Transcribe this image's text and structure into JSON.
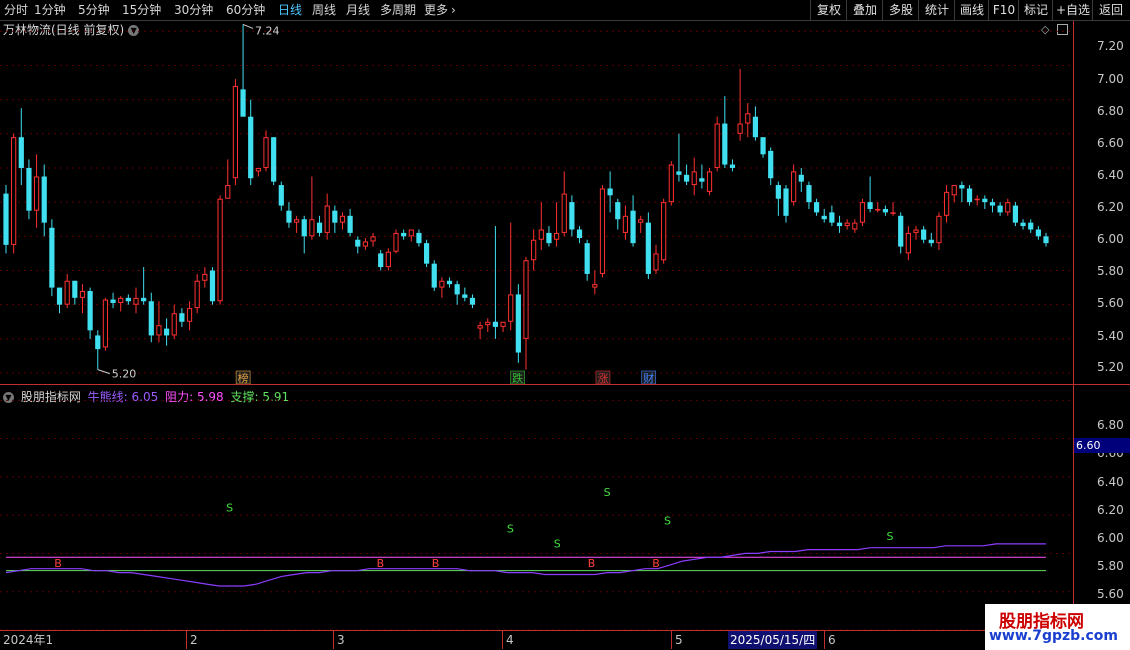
{
  "toolbar": {
    "periods": [
      "分时",
      "1分钟",
      "5分钟",
      "15分钟",
      "30分钟",
      "60分钟",
      "日线",
      "周线",
      "月线",
      "多周期",
      "更多"
    ],
    "active": "日线",
    "right_buttons": [
      "复权",
      "叠加",
      "多股",
      "统计",
      "画线",
      "F10",
      "标记",
      "+自选",
      "返回"
    ]
  },
  "stock": {
    "title": "万林物流(日线 前复权)"
  },
  "main_axis": {
    "ticks": [
      "7.20",
      "7.00",
      "6.80",
      "6.60",
      "6.40",
      "6.20",
      "6.00",
      "5.80",
      "5.60",
      "5.40",
      "5.20"
    ]
  },
  "annotations": {
    "high": "7.24",
    "low": "5.20"
  },
  "event_badges": [
    {
      "label": "榜",
      "color": "#e0a040"
    },
    {
      "label": "跌",
      "color": "#30c030"
    },
    {
      "label": "涨",
      "color": "#e03030"
    },
    {
      "label": "财",
      "color": "#4080ff"
    }
  ],
  "indicator": {
    "name": "股朋指标网",
    "bull_label": "牛熊线:",
    "bull_value": "6.05",
    "resist_label": "阻力:",
    "resist_value": "5.98",
    "support_label": "支撑:",
    "support_value": "5.91",
    "signal_s": "S",
    "signal_b": "B"
  },
  "sub_axis": {
    "ticks": [
      "6.80",
      "6.60",
      "6.40",
      "6.20",
      "6.00",
      "5.80",
      "5.60"
    ],
    "cursor_value": "6.60"
  },
  "date_axis": {
    "labels": [
      "2024年1",
      "2",
      "3",
      "4",
      "5",
      "6"
    ],
    "cursor": "2025/05/15/四"
  },
  "watermark": {
    "title": "股朋指标网",
    "url": "www.7gpzb.com"
  },
  "colors": {
    "up": "#ff3030",
    "down": "#40e0f0",
    "bull": "#8c3cff",
    "resist": "#ff50ff",
    "support": "#60e060"
  },
  "chart_data": {
    "type": "candlestick",
    "price_range": [
      5.13,
      7.26
    ],
    "indicator_range": [
      5.6,
      6.88
    ],
    "candles": [
      [
        6.25,
        6.3,
        5.9,
        5.95
      ],
      [
        5.95,
        6.6,
        5.9,
        6.58
      ],
      [
        6.58,
        6.75,
        6.3,
        6.4
      ],
      [
        6.4,
        6.45,
        6.1,
        6.15
      ],
      [
        6.15,
        6.48,
        6.05,
        6.35
      ],
      [
        6.35,
        6.42,
        6.0,
        6.08
      ],
      [
        6.05,
        6.1,
        5.65,
        5.7
      ],
      [
        5.7,
        5.7,
        5.55,
        5.6
      ],
      [
        5.6,
        5.78,
        5.58,
        5.74
      ],
      [
        5.74,
        5.74,
        5.6,
        5.64
      ],
      [
        5.64,
        5.72,
        5.55,
        5.68
      ],
      [
        5.68,
        5.7,
        5.4,
        5.45
      ],
      [
        5.42,
        5.45,
        5.22,
        5.34
      ],
      [
        5.35,
        5.64,
        5.33,
        5.63
      ],
      [
        5.63,
        5.67,
        5.58,
        5.61
      ],
      [
        5.61,
        5.65,
        5.56,
        5.64
      ],
      [
        5.64,
        5.66,
        5.6,
        5.62
      ],
      [
        5.6,
        5.7,
        5.55,
        5.64
      ],
      [
        5.64,
        5.82,
        5.6,
        5.62
      ],
      [
        5.62,
        5.67,
        5.38,
        5.42
      ],
      [
        5.42,
        5.62,
        5.38,
        5.48
      ],
      [
        5.46,
        5.52,
        5.36,
        5.42
      ],
      [
        5.42,
        5.6,
        5.4,
        5.55
      ],
      [
        5.55,
        5.58,
        5.47,
        5.5
      ],
      [
        5.5,
        5.62,
        5.45,
        5.58
      ],
      [
        5.58,
        5.78,
        5.55,
        5.74
      ],
      [
        5.74,
        5.82,
        5.7,
        5.78
      ],
      [
        5.8,
        5.82,
        5.6,
        5.62
      ],
      [
        5.62,
        6.24,
        5.6,
        6.22
      ],
      [
        6.22,
        6.45,
        6.22,
        6.3
      ],
      [
        6.34,
        6.92,
        6.3,
        6.88
      ],
      [
        6.86,
        7.24,
        6.78,
        6.7
      ],
      [
        6.7,
        6.8,
        6.3,
        6.34
      ],
      [
        6.38,
        6.4,
        6.35,
        6.4
      ],
      [
        6.4,
        6.62,
        6.38,
        6.58
      ],
      [
        6.58,
        6.58,
        6.3,
        6.32
      ],
      [
        6.3,
        6.32,
        6.15,
        6.18
      ],
      [
        6.15,
        6.2,
        6.05,
        6.08
      ],
      [
        6.08,
        6.12,
        6.02,
        6.1
      ],
      [
        6.1,
        6.12,
        5.9,
        6.0
      ],
      [
        6.0,
        6.35,
        5.98,
        6.1
      ],
      [
        6.08,
        6.12,
        6.0,
        6.02
      ],
      [
        6.02,
        6.25,
        5.98,
        6.18
      ],
      [
        6.15,
        6.18,
        6.02,
        6.08
      ],
      [
        6.08,
        6.14,
        6.04,
        6.12
      ],
      [
        6.12,
        6.16,
        6.0,
        6.02
      ],
      [
        5.98,
        6.0,
        5.9,
        5.94
      ],
      [
        5.94,
        5.99,
        5.92,
        5.97
      ],
      [
        5.97,
        6.02,
        5.94,
        6.0
      ],
      [
        5.9,
        5.92,
        5.8,
        5.82
      ],
      [
        5.82,
        5.93,
        5.8,
        5.91
      ],
      [
        5.91,
        6.04,
        5.9,
        6.02
      ],
      [
        6.02,
        6.04,
        5.98,
        6.0
      ],
      [
        6.0,
        6.04,
        5.97,
        6.04
      ],
      [
        6.02,
        6.04,
        5.94,
        5.96
      ],
      [
        5.96,
        5.98,
        5.82,
        5.84
      ],
      [
        5.84,
        5.86,
        5.68,
        5.7
      ],
      [
        5.7,
        5.76,
        5.64,
        5.74
      ],
      [
        5.74,
        5.76,
        5.7,
        5.72
      ],
      [
        5.72,
        5.74,
        5.6,
        5.66
      ],
      [
        5.66,
        5.7,
        5.62,
        5.64
      ],
      [
        5.64,
        5.66,
        5.58,
        5.6
      ],
      [
        5.46,
        5.5,
        5.4,
        5.48
      ],
      [
        5.48,
        5.52,
        5.44,
        5.5
      ],
      [
        5.5,
        6.06,
        5.4,
        5.47
      ],
      [
        5.47,
        5.5,
        5.44,
        5.5
      ],
      [
        5.5,
        6.08,
        5.45,
        5.66
      ],
      [
        5.66,
        5.72,
        5.26,
        5.32
      ],
      [
        5.4,
        5.88,
        5.22,
        5.86
      ],
      [
        5.86,
        6.04,
        5.8,
        5.98
      ],
      [
        5.98,
        6.2,
        5.92,
        6.04
      ],
      [
        6.02,
        6.06,
        5.94,
        5.96
      ],
      [
        5.98,
        6.2,
        5.94,
        6.02
      ],
      [
        6.02,
        6.38,
        6.0,
        6.25
      ],
      [
        6.2,
        6.24,
        6.0,
        6.04
      ],
      [
        6.04,
        6.06,
        5.96,
        5.99
      ],
      [
        5.96,
        5.98,
        5.74,
        5.78
      ],
      [
        5.7,
        5.8,
        5.66,
        5.72
      ],
      [
        5.78,
        6.3,
        5.76,
        6.28
      ],
      [
        6.28,
        6.38,
        6.14,
        6.24
      ],
      [
        6.2,
        6.22,
        6.04,
        6.1
      ],
      [
        6.02,
        6.18,
        5.98,
        6.12
      ],
      [
        6.15,
        6.24,
        5.94,
        5.96
      ],
      [
        6.08,
        6.12,
        6.02,
        6.1
      ],
      [
        6.08,
        6.14,
        5.75,
        5.78
      ],
      [
        5.8,
        5.95,
        5.78,
        5.9
      ],
      [
        5.86,
        6.22,
        5.84,
        6.2
      ],
      [
        6.2,
        6.44,
        6.18,
        6.42
      ],
      [
        6.38,
        6.6,
        6.32,
        6.36
      ],
      [
        6.36,
        6.42,
        6.3,
        6.32
      ],
      [
        6.3,
        6.46,
        6.24,
        6.38
      ],
      [
        6.34,
        6.42,
        6.28,
        6.32
      ],
      [
        6.26,
        6.4,
        6.24,
        6.38
      ],
      [
        6.4,
        6.7,
        6.38,
        6.66
      ],
      [
        6.66,
        6.82,
        6.4,
        6.42
      ],
      [
        6.42,
        6.45,
        6.38,
        6.4
      ],
      [
        6.6,
        6.98,
        6.56,
        6.66
      ],
      [
        6.66,
        6.78,
        6.58,
        6.72
      ],
      [
        6.7,
        6.76,
        6.56,
        6.58
      ],
      [
        6.58,
        6.58,
        6.46,
        6.48
      ],
      [
        6.5,
        6.52,
        6.3,
        6.34
      ],
      [
        6.3,
        6.32,
        6.12,
        6.22
      ],
      [
        6.28,
        6.3,
        6.08,
        6.12
      ],
      [
        6.2,
        6.42,
        6.18,
        6.38
      ],
      [
        6.36,
        6.4,
        6.26,
        6.32
      ],
      [
        6.3,
        6.32,
        6.16,
        6.2
      ],
      [
        6.2,
        6.22,
        6.12,
        6.14
      ],
      [
        6.12,
        6.16,
        6.08,
        6.1
      ],
      [
        6.14,
        6.18,
        6.06,
        6.08
      ],
      [
        6.08,
        6.12,
        6.02,
        6.06
      ],
      [
        6.06,
        6.1,
        6.04,
        6.08
      ],
      [
        6.04,
        6.1,
        6.02,
        6.08
      ],
      [
        6.08,
        6.22,
        6.06,
        6.2
      ],
      [
        6.2,
        6.35,
        6.14,
        6.16
      ],
      [
        6.16,
        6.2,
        6.14,
        6.16
      ],
      [
        6.16,
        6.18,
        6.12,
        6.14
      ],
      [
        6.14,
        6.2,
        6.12,
        6.14
      ],
      [
        6.12,
        6.14,
        5.9,
        5.94
      ],
      [
        5.9,
        6.06,
        5.86,
        6.02
      ],
      [
        6.02,
        6.06,
        5.98,
        6.04
      ],
      [
        6.04,
        6.06,
        5.96,
        5.98
      ],
      [
        5.98,
        6.02,
        5.94,
        5.96
      ],
      [
        5.96,
        6.14,
        5.92,
        6.12
      ],
      [
        6.12,
        6.3,
        6.08,
        6.26
      ],
      [
        6.24,
        6.3,
        6.2,
        6.3
      ],
      [
        6.3,
        6.32,
        6.2,
        6.28
      ],
      [
        6.28,
        6.3,
        6.18,
        6.2
      ],
      [
        6.22,
        6.24,
        6.18,
        6.22
      ],
      [
        6.22,
        6.24,
        6.16,
        6.2
      ],
      [
        6.2,
        6.22,
        6.14,
        6.18
      ],
      [
        6.18,
        6.2,
        6.12,
        6.14
      ],
      [
        6.14,
        6.22,
        6.12,
        6.2
      ],
      [
        6.18,
        6.2,
        6.06,
        6.08
      ],
      [
        6.08,
        6.1,
        6.04,
        6.06
      ],
      [
        6.08,
        6.1,
        6.02,
        6.04
      ],
      [
        6.04,
        6.06,
        5.98,
        6.0
      ],
      [
        6.0,
        6.02,
        5.94,
        5.96
      ]
    ],
    "bull_line": [
      5.9,
      5.91,
      5.92,
      5.92,
      5.92,
      5.92,
      5.92,
      5.91,
      5.91,
      5.9,
      5.9,
      5.89,
      5.88,
      5.87,
      5.86,
      5.85,
      5.84,
      5.83,
      5.83,
      5.83,
      5.84,
      5.86,
      5.88,
      5.89,
      5.9,
      5.9,
      5.91,
      5.91,
      5.91,
      5.92,
      5.92,
      5.92,
      5.92,
      5.92,
      5.92,
      5.92,
      5.92,
      5.91,
      5.91,
      5.91,
      5.9,
      5.9,
      5.9,
      5.89,
      5.89,
      5.89,
      5.89,
      5.89,
      5.9,
      5.9,
      5.91,
      5.92,
      5.92,
      5.94,
      5.96,
      5.97,
      5.98,
      5.98,
      5.99,
      6.0,
      6.0,
      6.01,
      6.01,
      6.01,
      6.02,
      6.02,
      6.02,
      6.02,
      6.02,
      6.03,
      6.03,
      6.03,
      6.03,
      6.03,
      6.03,
      6.04,
      6.04,
      6.04,
      6.04,
      6.05,
      6.05,
      6.05,
      6.05,
      6.05
    ],
    "resist_value": 5.98,
    "support_value": 5.91,
    "s_signals": [
      [
        0.215,
        6.22
      ],
      [
        0.485,
        6.11
      ],
      [
        0.53,
        6.03
      ],
      [
        0.578,
        6.3
      ],
      [
        0.636,
        6.15
      ],
      [
        0.85,
        6.07
      ]
    ],
    "b_signals": [
      [
        0.05,
        5.97
      ],
      [
        0.36,
        5.97
      ],
      [
        0.413,
        5.97
      ],
      [
        0.563,
        5.97
      ],
      [
        0.625,
        5.97
      ]
    ],
    "badge_positions": [
      0.228,
      0.492,
      0.574,
      0.618
    ],
    "high_index": 31,
    "low_index": 12
  }
}
